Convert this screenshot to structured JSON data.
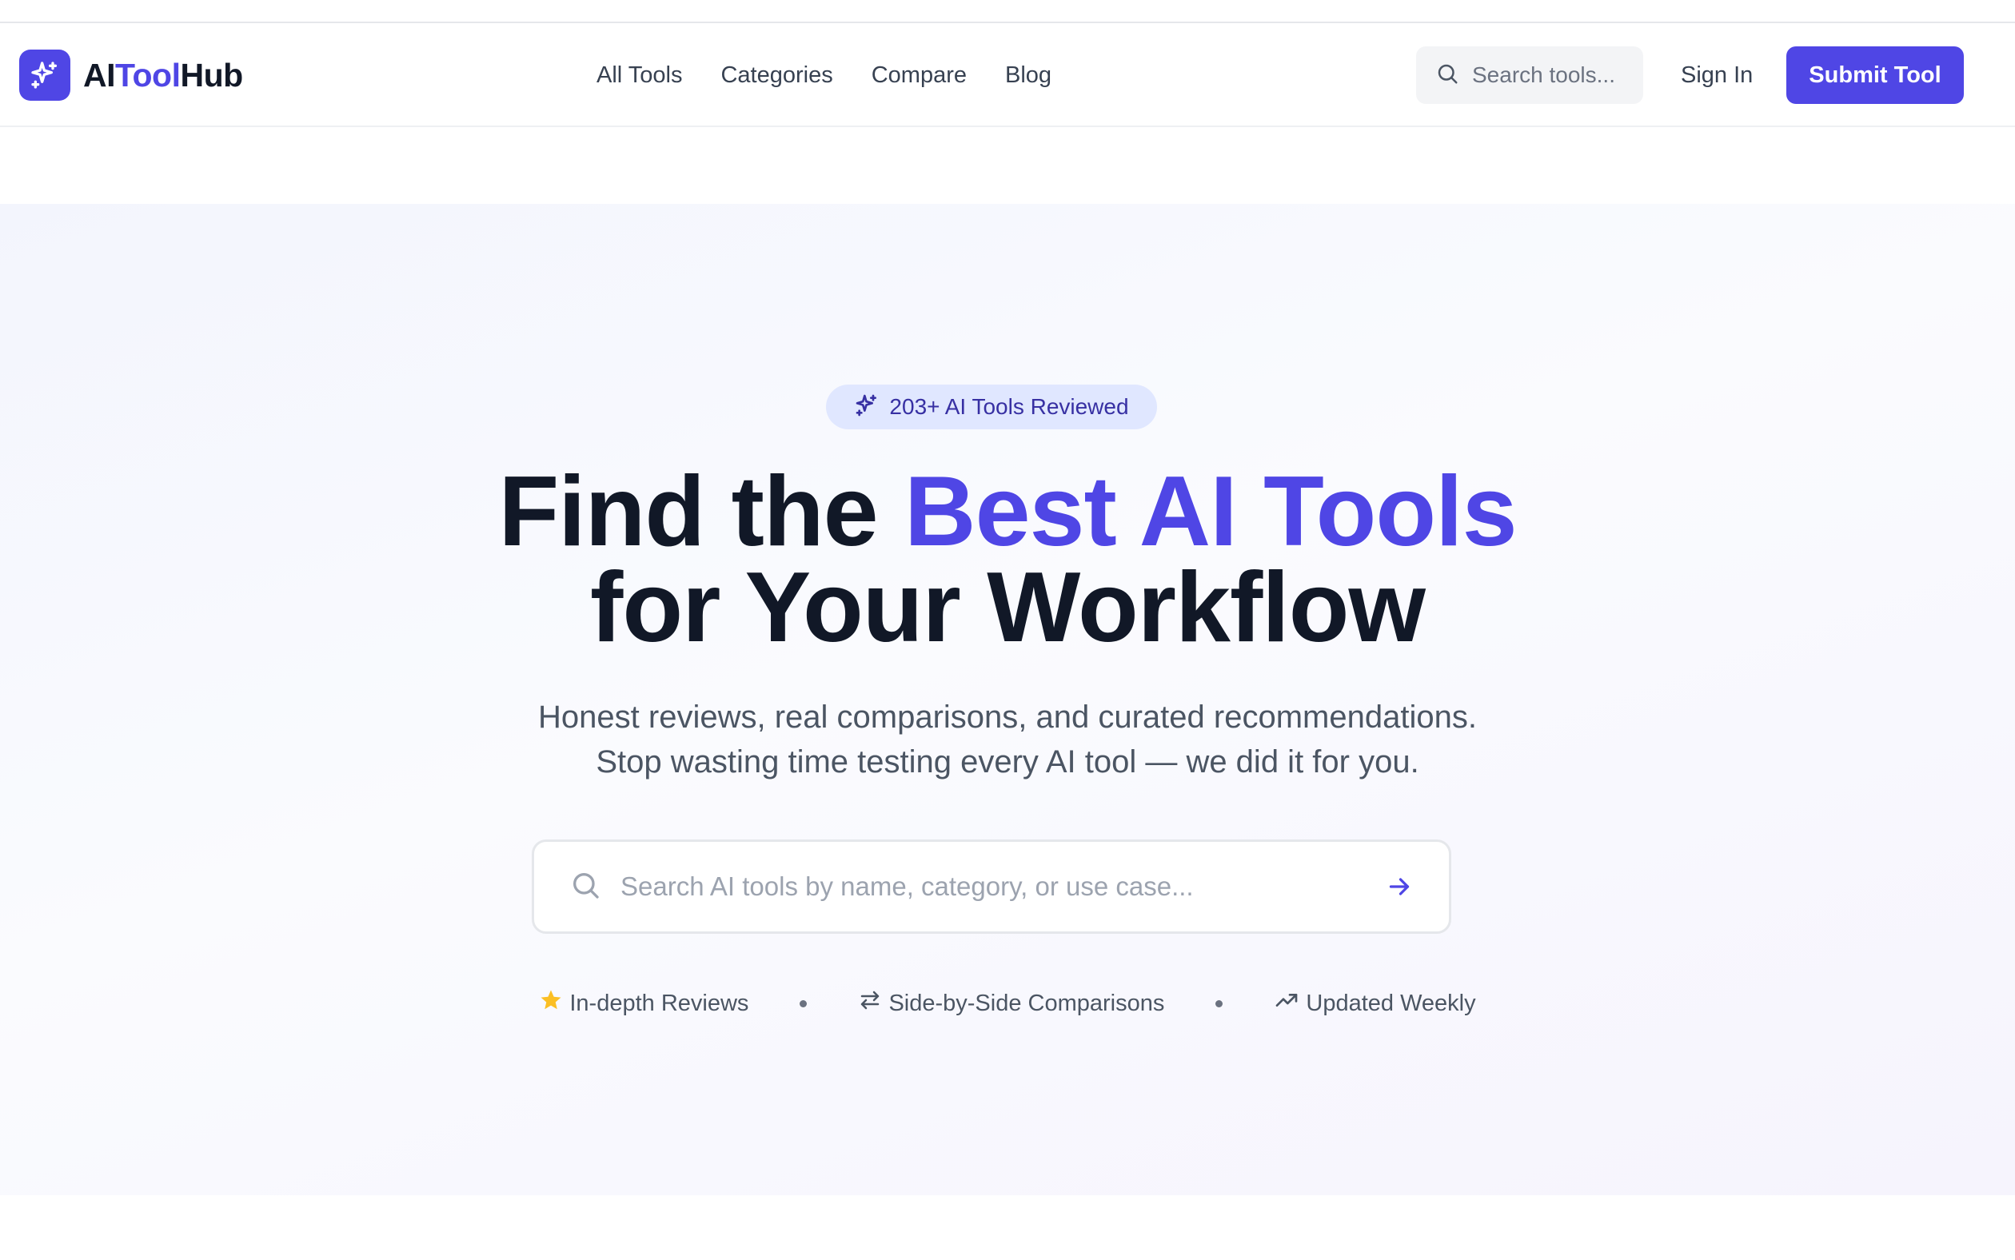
{
  "brand": {
    "prefix": "AI",
    "accent": "Tool",
    "suffix": "Hub",
    "accent_color": "#4f46e5"
  },
  "nav": {
    "links": [
      "All Tools",
      "Categories",
      "Compare",
      "Blog"
    ],
    "search_placeholder": "Search tools...",
    "sign_in": "Sign In",
    "submit": "Submit Tool"
  },
  "hero": {
    "badge": "203+ AI Tools Reviewed",
    "title_line1_start": "Find the ",
    "title_line1_accent": "Best AI Tools",
    "title_line2": "for Your Workflow",
    "subtitle_line1": "Honest reviews, real comparisons, and curated recommendations.",
    "subtitle_line2": "Stop wasting time testing every AI tool — we did it for you.",
    "search_placeholder": "Search AI tools by name, category, or use case...",
    "features": [
      {
        "icon": "star-icon",
        "label": "In-depth Reviews"
      },
      {
        "icon": "arrows-swap-icon",
        "label": "Side-by-Side Comparisons"
      },
      {
        "icon": "trending-up-icon",
        "label": "Updated Weekly"
      }
    ]
  },
  "colors": {
    "primary": "#4f46e5",
    "text": "#111827",
    "muted": "#4b5563",
    "star": "#fbbf24"
  }
}
